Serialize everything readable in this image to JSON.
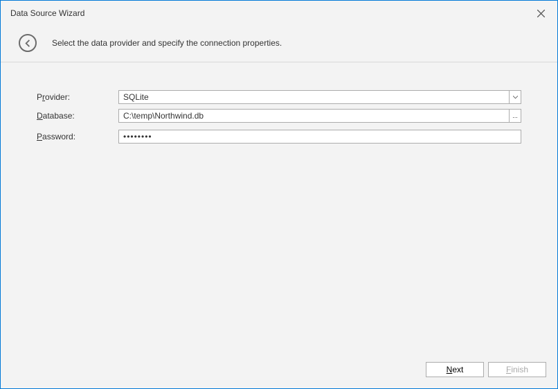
{
  "window": {
    "title": "Data Source Wizard"
  },
  "header": {
    "instruction": "Select the data provider and specify the connection properties."
  },
  "form": {
    "provider": {
      "label_pre": "P",
      "label_u": "r",
      "label_post": "ovider:",
      "value": "SQLite"
    },
    "database": {
      "label_u": "D",
      "label_post": "atabase:",
      "value": "C:\\temp\\Northwind.db",
      "browse_label": "..."
    },
    "password": {
      "label_u": "P",
      "label_post": "assword:",
      "masked": "••••••••"
    }
  },
  "footer": {
    "next_u": "N",
    "next_post": "ext",
    "finish_u": "F",
    "finish_post": "inish"
  }
}
